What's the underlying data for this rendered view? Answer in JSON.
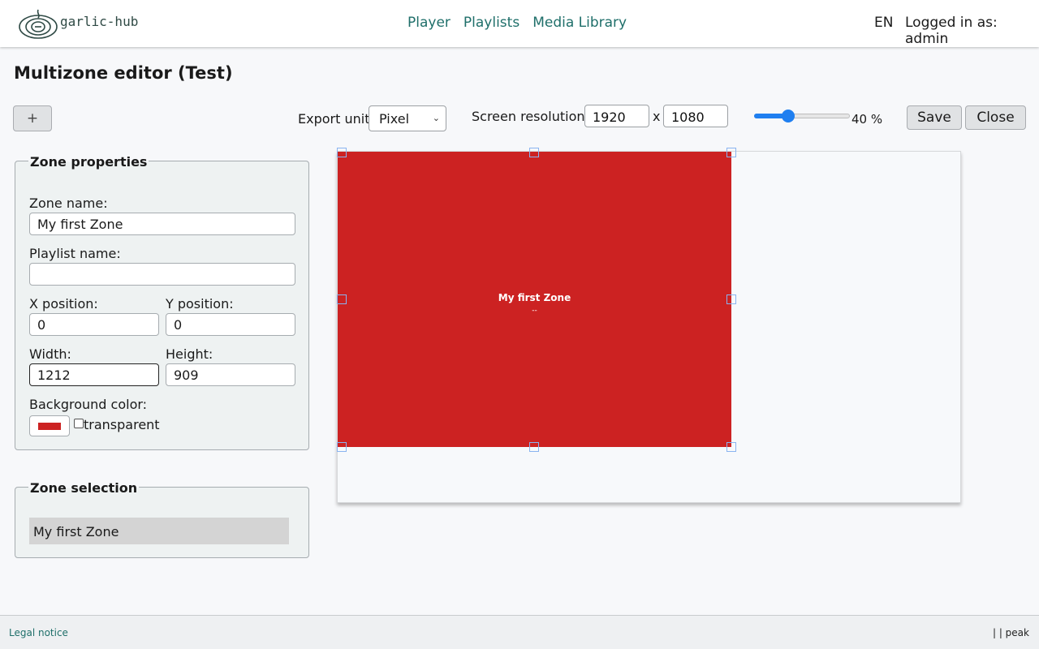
{
  "header": {
    "logo_text": "garlic-hub",
    "nav": [
      "Player",
      "Playlists",
      "Media Library"
    ],
    "language": "EN",
    "user_text": "Logged in as: admin"
  },
  "page": {
    "title": "Multizone editor (Test)"
  },
  "toolbar": {
    "add_label": "+",
    "export_unit_label": "Export unit",
    "export_unit_value": "Pixel",
    "screen_resolution_label": "Screen resolution:",
    "resolution_width": "1920",
    "resolution_separator": "x",
    "resolution_height": "1080",
    "zoom_percent": 40,
    "zoom_text": "40 %",
    "save_label": "Save",
    "close_label": "Close"
  },
  "zone_properties": {
    "legend": "Zone properties",
    "zone_name_label": "Zone name:",
    "zone_name_value": "My first Zone",
    "playlist_name_label": "Playlist name:",
    "playlist_name_value": "",
    "x_label": "X position:",
    "x_value": "0",
    "y_label": "Y position:",
    "y_value": "0",
    "width_label": "Width:",
    "width_value": "1212",
    "height_label": "Height:",
    "height_value": "909",
    "bg_color_label": "Background color:",
    "bg_color": "#cc2222",
    "transparent_label": "transparent"
  },
  "zone_selection": {
    "legend": "Zone selection",
    "items": [
      "My first Zone"
    ]
  },
  "canvas": {
    "zone_label": "My first Zone",
    "zone_sublabel": "--",
    "zone_color": "#cc2222"
  },
  "footer": {
    "legal": "Legal notice",
    "right_text": "| | peak"
  }
}
